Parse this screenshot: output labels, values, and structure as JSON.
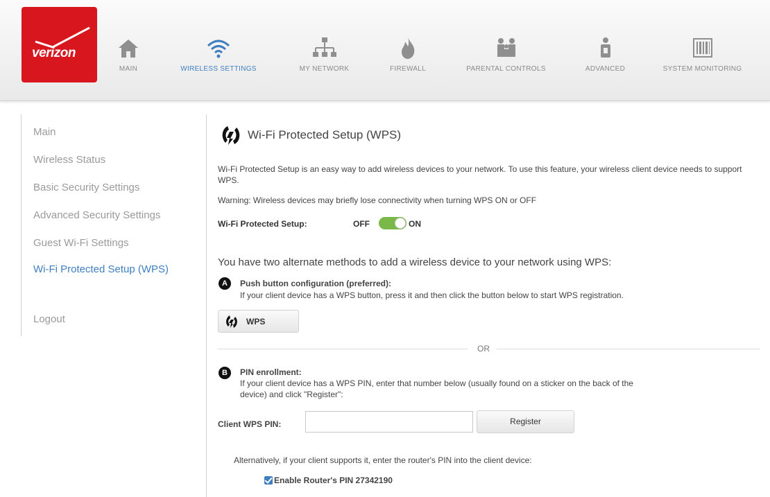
{
  "brand": {
    "logo_text": "verizon",
    "color": "#d8161e"
  },
  "nav": {
    "main": "MAIN",
    "wireless_settings": "WIRELESS SETTINGS",
    "my_network": "MY NETWORK",
    "firewall": "FIREWALL",
    "parental_controls": "PARENTAL CONTROLS",
    "advanced": "ADVANCED",
    "system_monitoring": "SYSTEM MONITORING",
    "active": "WIRELESS SETTINGS",
    "active_color": "#3f7fc1"
  },
  "sidebar": {
    "items": [
      {
        "label": "Main"
      },
      {
        "label": "Wireless Status"
      },
      {
        "label": "Basic Security Settings"
      },
      {
        "label": "Advanced Security Settings"
      },
      {
        "label": "Guest Wi-Fi Settings"
      },
      {
        "label": "Wi-Fi Protected Setup (WPS)",
        "active": true
      },
      {
        "label": "Logout"
      }
    ]
  },
  "page": {
    "title": "Wi-Fi Protected Setup (WPS)",
    "description": "Wi-Fi Protected Setup is an easy way to add wireless devices to your network. To use this feature, your wireless client device needs to support WPS.",
    "warning": "Warning: Wireless devices may briefly lose connectivity when turning WPS ON or OFF",
    "toggle": {
      "label": "Wi-Fi Protected Setup:",
      "off_label": "OFF",
      "on_label": "ON",
      "state": "ON"
    },
    "methods_intro": "You have two alternate methods to add a wireless device to your network using WPS:",
    "method_a": {
      "badge": "A",
      "title": "Push button configuration (preferred):",
      "description": "If your client device has a WPS button, press it and then click the button below to start WPS registration.",
      "button_label": "WPS"
    },
    "or_text": "OR",
    "method_b": {
      "badge": "B",
      "title": "PIN enrollment:",
      "description_line1": "If your client device has a WPS PIN, enter that number below (usually found on a sticker on the back of the",
      "description_line2": "device) and click \"Register\":",
      "pin_label": "Client WPS PIN:",
      "pin_value": "",
      "register_label": "Register"
    },
    "alternative_text": "Alternatively, if your client supports it, enter the router's PIN into the client device:",
    "router_pin": {
      "label": "Enable Router's PIN 27342190",
      "checked": true
    }
  }
}
